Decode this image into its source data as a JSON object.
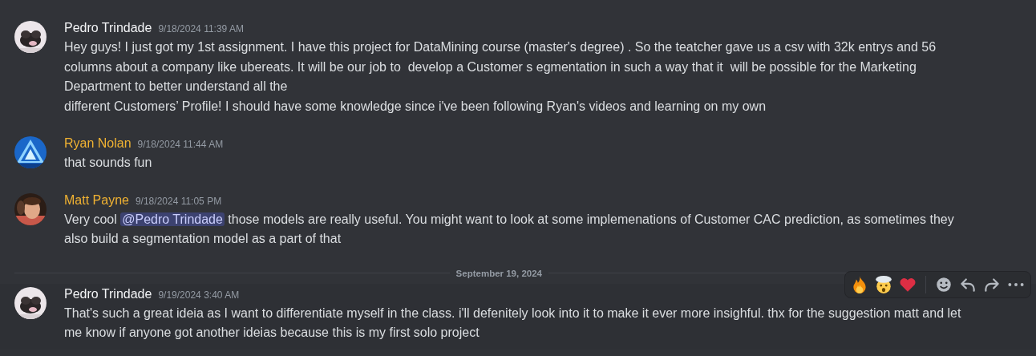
{
  "messages": [
    {
      "author": "Pedro Trindade",
      "color": "#f2f3f5",
      "timestamp": "9/18/2024 11:39 AM",
      "hovered": false,
      "body": [
        {
          "kind": "text",
          "text": "Hey guys! I just got my 1st assignment. I have this project for DataMining course (master's degree) . So the teatcher gave us a csv with 32k entrys and 56 columns about a company like ubereats. It will be our job to  develop a Customer s egmentation in such a way that it  will be possible for the Marketing Department to better understand all the\ndifferent Customers’ Profile! I should have some knowledge since i've been following Ryan's videos and learning on my own"
        }
      ]
    },
    {
      "author": "Ryan Nolan",
      "color": "#f0b232",
      "timestamp": "9/18/2024 11:44 AM",
      "hovered": false,
      "body": [
        {
          "kind": "text",
          "text": "that sounds fun"
        }
      ]
    },
    {
      "author": "Matt Payne",
      "color": "#f0b232",
      "timestamp": "9/18/2024 11:05 PM",
      "hovered": false,
      "body": [
        {
          "kind": "text",
          "text": "Very cool "
        },
        {
          "kind": "mention",
          "text": "@Pedro Trindade"
        },
        {
          "kind": "text",
          "text": " those models are really useful. You might want to look at some implemenations of Customer CAC prediction, as sometimes they also build a segmentation model as a part of that"
        }
      ]
    },
    {
      "kind": "divider",
      "date": "September 19, 2024"
    },
    {
      "author": "Pedro Trindade",
      "color": "#f2f3f5",
      "timestamp": "9/19/2024 3:40 AM",
      "hovered": true,
      "body": [
        {
          "kind": "text",
          "text": "That's such a great ideia as I want to differentiate myself in the class. i'll defenitely look into it to make it ever more insighful. thx for the suggestion matt and let me know if anyone got another ideias because this is my first solo project"
        }
      ]
    }
  ]
}
